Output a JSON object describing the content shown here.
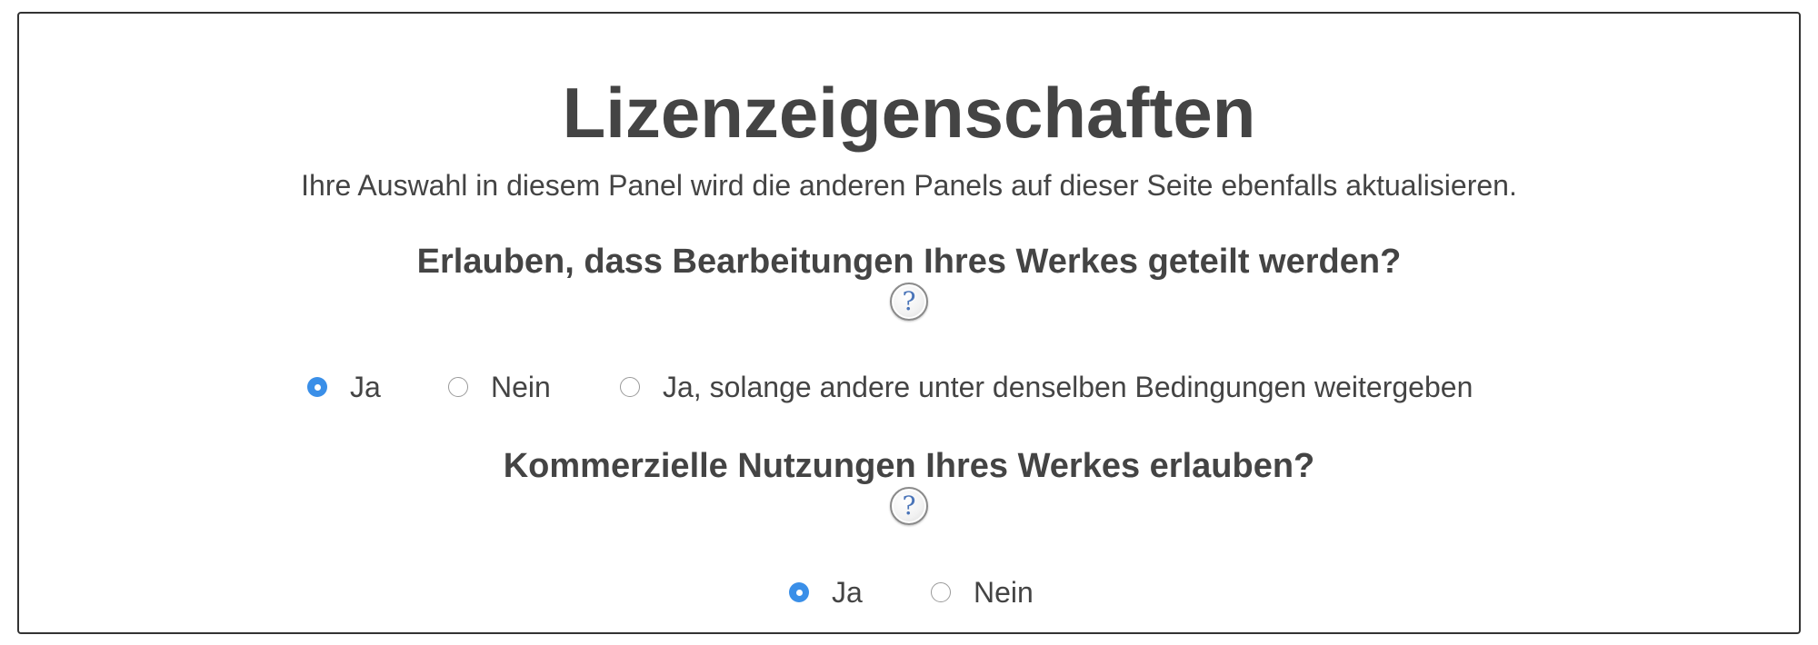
{
  "panel": {
    "title": "Lizenzeigenschaften",
    "subtitle": "Ihre Auswahl in diesem Panel wird die anderen Panels auf dieser Seite ebenfalls aktualisieren."
  },
  "questions": [
    {
      "text": "Erlauben, dass Bearbeitungen Ihres Werkes geteilt werden?",
      "help_icon": "?",
      "options": [
        {
          "label": "Ja",
          "selected": true
        },
        {
          "label": "Nein",
          "selected": false
        },
        {
          "label": "Ja, solange andere unter denselben Bedingungen weitergeben",
          "selected": false
        }
      ]
    },
    {
      "text": "Kommerzielle Nutzungen Ihres Werkes erlauben?",
      "help_icon": "?",
      "options": [
        {
          "label": "Ja",
          "selected": true
        },
        {
          "label": "Nein",
          "selected": false
        }
      ]
    }
  ],
  "colors": {
    "text": "#444444",
    "radio_selected": "#3a8fe8",
    "border": "#333333",
    "help_glyph": "#4a74b8"
  }
}
